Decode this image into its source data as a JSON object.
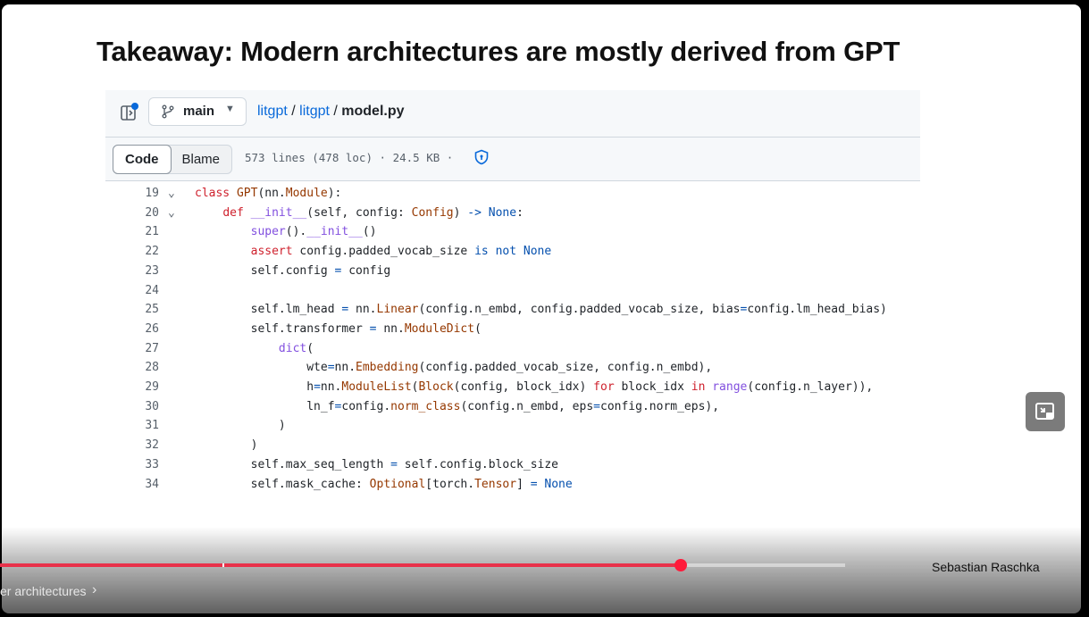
{
  "slide": {
    "title": "Takeaway: Modern architectures are mostly derived from GPT"
  },
  "github": {
    "branch": "main",
    "breadcrumb": {
      "repo": "litgpt",
      "sep1": " / ",
      "folder": "litgpt",
      "sep2": " / ",
      "file": "model.py"
    },
    "tabs": {
      "code": "Code",
      "blame": "Blame"
    },
    "file_info": "573 lines (478 loc) · 24.5 KB ·",
    "code_lines": [
      {
        "n": "19",
        "fold": true
      },
      {
        "n": "20",
        "fold": true
      },
      {
        "n": "21"
      },
      {
        "n": "22"
      },
      {
        "n": "23"
      },
      {
        "n": "24"
      },
      {
        "n": "25"
      },
      {
        "n": "26"
      },
      {
        "n": "27"
      },
      {
        "n": "28"
      },
      {
        "n": "29"
      },
      {
        "n": "30"
      },
      {
        "n": "31"
      },
      {
        "n": "32"
      },
      {
        "n": "33"
      },
      {
        "n": "34"
      }
    ]
  },
  "player": {
    "author": "Sebastian Raschka",
    "chapter": "er architectures",
    "progress_fraction": 0.806
  },
  "icons": [
    "sidebar-toggle-icon",
    "git-branch-icon",
    "chevron-down-icon",
    "shield-icon",
    "fold-chevron-icon",
    "chevron-right-icon",
    "picture-in-picture-icon"
  ]
}
